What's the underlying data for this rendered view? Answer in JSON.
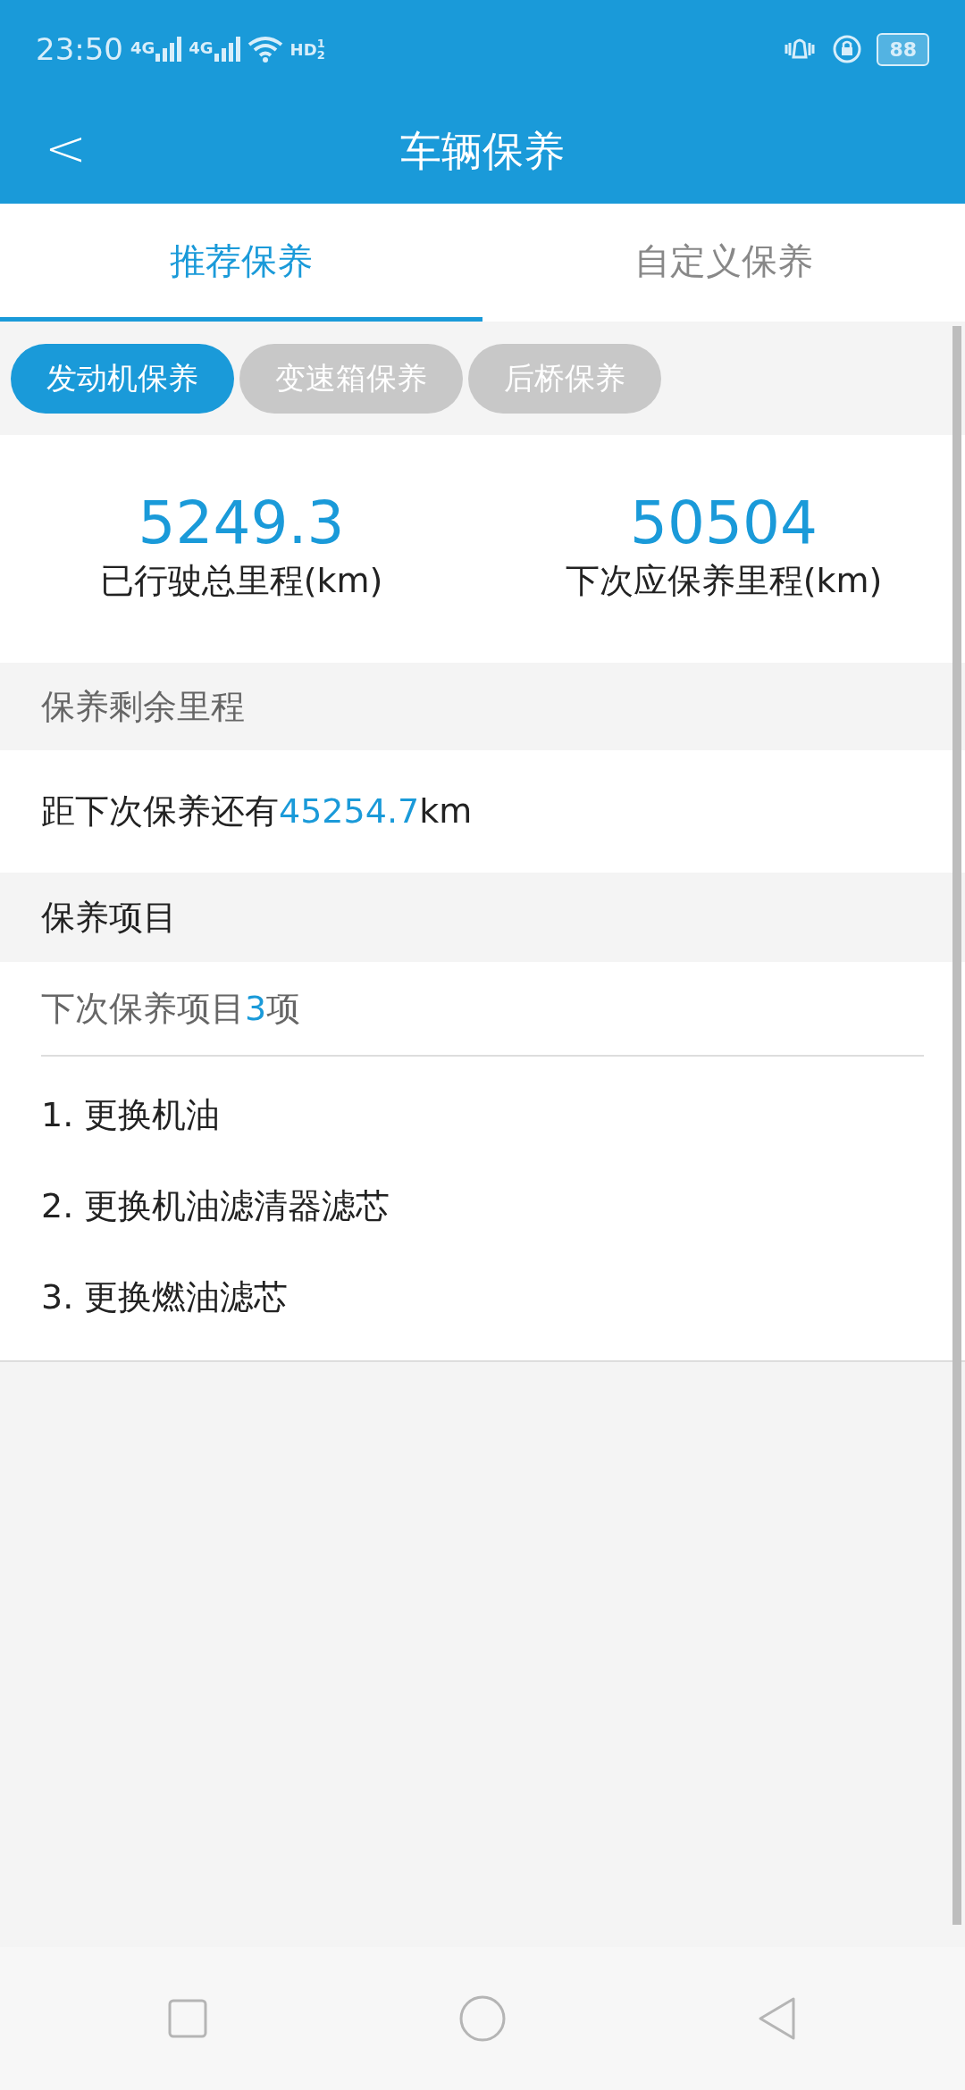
{
  "status_bar": {
    "time": "23:50",
    "network_labels": [
      "4G",
      "4G"
    ],
    "hd": "HD",
    "sim_slots": [
      "1",
      "2"
    ],
    "battery": "88"
  },
  "header": {
    "back": "<",
    "title": "车辆保养"
  },
  "tabs": [
    {
      "label": "推荐保养",
      "selected": true
    },
    {
      "label": "自定义保养",
      "selected": false
    }
  ],
  "chips": [
    {
      "label": "发动机保养",
      "selected": true
    },
    {
      "label": "变速箱保养",
      "selected": false
    },
    {
      "label": "后桥保养",
      "selected": false
    }
  ],
  "stats": [
    {
      "value": "5249.3",
      "label": "已行驶总里程(km)"
    },
    {
      "value": "50504",
      "label": "下次应保养里程(km)"
    }
  ],
  "remaining": {
    "heading": "保养剩余里程",
    "prefix": "距下次保养还有",
    "value": "45254.7",
    "unit": "km"
  },
  "items_section": {
    "heading": "保养项目",
    "summary_prefix": "下次保养项目",
    "count": "3",
    "summary_suffix": "项",
    "items": [
      "1. 更换机油",
      "2. 更换机油滤清器滤芯",
      "3. 更换燃油滤芯"
    ]
  }
}
